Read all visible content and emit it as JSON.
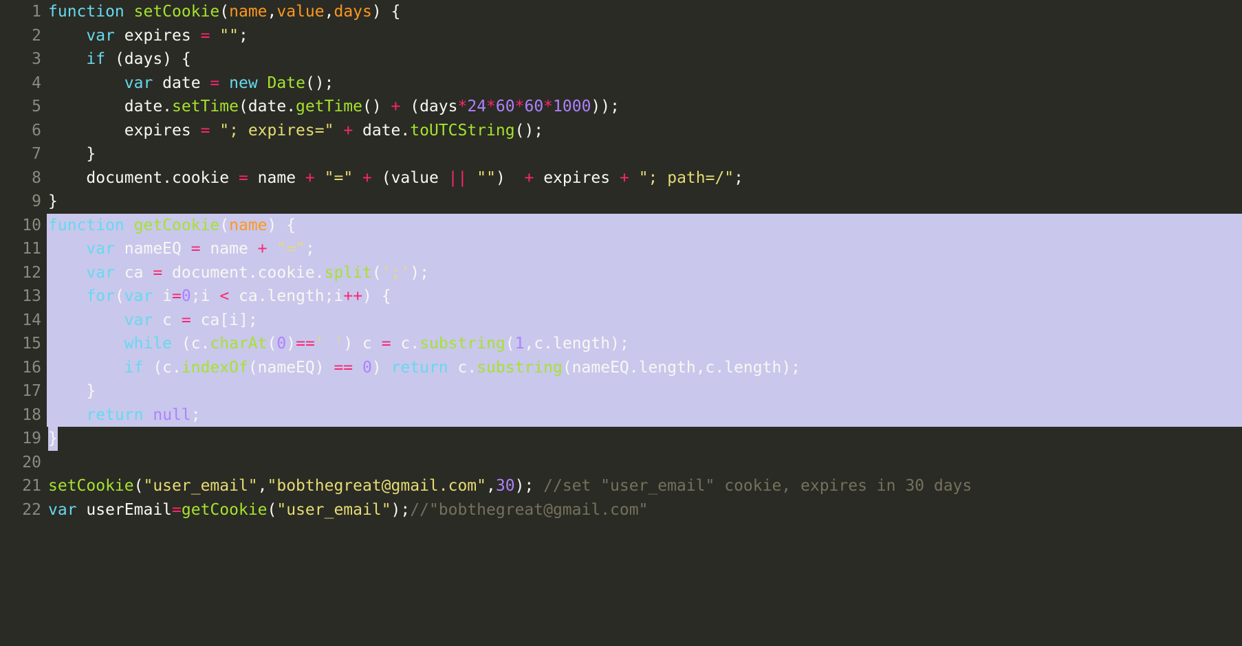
{
  "lineNumbers": [
    "1",
    "2",
    "3",
    "4",
    "5",
    "6",
    "7",
    "8",
    "9",
    "10",
    "11",
    "12",
    "13",
    "14",
    "15",
    "16",
    "17",
    "18",
    "19",
    "20",
    "21",
    "22"
  ],
  "selection": {
    "startLine": 10,
    "endLine": 19
  },
  "code": {
    "lines": [
      [
        {
          "t": "kw",
          "v": "function"
        },
        {
          "t": "id",
          "v": " "
        },
        {
          "t": "fn",
          "v": "setCookie"
        },
        {
          "t": "id",
          "v": "("
        },
        {
          "t": "arg",
          "v": "name"
        },
        {
          "t": "id",
          "v": ","
        },
        {
          "t": "arg",
          "v": "value"
        },
        {
          "t": "id",
          "v": ","
        },
        {
          "t": "arg",
          "v": "days"
        },
        {
          "t": "id",
          "v": ") {"
        }
      ],
      [
        {
          "t": "id",
          "v": "    "
        },
        {
          "t": "kw",
          "v": "var"
        },
        {
          "t": "id",
          "v": " expires "
        },
        {
          "t": "op",
          "v": "="
        },
        {
          "t": "id",
          "v": " "
        },
        {
          "t": "str",
          "v": "\"\""
        },
        {
          "t": "id",
          "v": ";"
        }
      ],
      [
        {
          "t": "id",
          "v": "    "
        },
        {
          "t": "kw",
          "v": "if"
        },
        {
          "t": "id",
          "v": " (days) {"
        }
      ],
      [
        {
          "t": "id",
          "v": "        "
        },
        {
          "t": "kw",
          "v": "var"
        },
        {
          "t": "id",
          "v": " date "
        },
        {
          "t": "op",
          "v": "="
        },
        {
          "t": "id",
          "v": " "
        },
        {
          "t": "kw",
          "v": "new"
        },
        {
          "t": "id",
          "v": " "
        },
        {
          "t": "fn",
          "v": "Date"
        },
        {
          "t": "id",
          "v": "();"
        }
      ],
      [
        {
          "t": "id",
          "v": "        date."
        },
        {
          "t": "fn",
          "v": "setTime"
        },
        {
          "t": "id",
          "v": "(date."
        },
        {
          "t": "fn",
          "v": "getTime"
        },
        {
          "t": "id",
          "v": "() "
        },
        {
          "t": "op",
          "v": "+"
        },
        {
          "t": "id",
          "v": " (days"
        },
        {
          "t": "op",
          "v": "*"
        },
        {
          "t": "num",
          "v": "24"
        },
        {
          "t": "op",
          "v": "*"
        },
        {
          "t": "num",
          "v": "60"
        },
        {
          "t": "op",
          "v": "*"
        },
        {
          "t": "num",
          "v": "60"
        },
        {
          "t": "op",
          "v": "*"
        },
        {
          "t": "num",
          "v": "1000"
        },
        {
          "t": "id",
          "v": "));"
        }
      ],
      [
        {
          "t": "id",
          "v": "        expires "
        },
        {
          "t": "op",
          "v": "="
        },
        {
          "t": "id",
          "v": " "
        },
        {
          "t": "str",
          "v": "\"; expires=\""
        },
        {
          "t": "id",
          "v": " "
        },
        {
          "t": "op",
          "v": "+"
        },
        {
          "t": "id",
          "v": " date."
        },
        {
          "t": "fn",
          "v": "toUTCString"
        },
        {
          "t": "id",
          "v": "();"
        }
      ],
      [
        {
          "t": "id",
          "v": "    }"
        }
      ],
      [
        {
          "t": "id",
          "v": "    document.cookie "
        },
        {
          "t": "op",
          "v": "="
        },
        {
          "t": "id",
          "v": " name "
        },
        {
          "t": "op",
          "v": "+"
        },
        {
          "t": "id",
          "v": " "
        },
        {
          "t": "str",
          "v": "\"=\""
        },
        {
          "t": "id",
          "v": " "
        },
        {
          "t": "op",
          "v": "+"
        },
        {
          "t": "id",
          "v": " (value "
        },
        {
          "t": "op",
          "v": "||"
        },
        {
          "t": "id",
          "v": " "
        },
        {
          "t": "str",
          "v": "\"\""
        },
        {
          "t": "id",
          "v": ")  "
        },
        {
          "t": "op",
          "v": "+"
        },
        {
          "t": "id",
          "v": " expires "
        },
        {
          "t": "op",
          "v": "+"
        },
        {
          "t": "id",
          "v": " "
        },
        {
          "t": "str",
          "v": "\"; path=/\""
        },
        {
          "t": "id",
          "v": ";"
        }
      ],
      [
        {
          "t": "id",
          "v": "}"
        }
      ],
      [
        {
          "t": "kw",
          "v": "function"
        },
        {
          "t": "id",
          "v": " "
        },
        {
          "t": "fn",
          "v": "getCookie"
        },
        {
          "t": "id",
          "v": "("
        },
        {
          "t": "arg",
          "v": "name"
        },
        {
          "t": "id",
          "v": ") {"
        }
      ],
      [
        {
          "t": "id",
          "v": "    "
        },
        {
          "t": "kw",
          "v": "var"
        },
        {
          "t": "id",
          "v": " nameEQ "
        },
        {
          "t": "op",
          "v": "="
        },
        {
          "t": "id",
          "v": " name "
        },
        {
          "t": "op",
          "v": "+"
        },
        {
          "t": "id",
          "v": " "
        },
        {
          "t": "str",
          "v": "\"=\""
        },
        {
          "t": "id",
          "v": ";"
        }
      ],
      [
        {
          "t": "id",
          "v": "    "
        },
        {
          "t": "kw",
          "v": "var"
        },
        {
          "t": "id",
          "v": " ca "
        },
        {
          "t": "op",
          "v": "="
        },
        {
          "t": "id",
          "v": " document.cookie."
        },
        {
          "t": "fn",
          "v": "split"
        },
        {
          "t": "id",
          "v": "("
        },
        {
          "t": "str",
          "v": "';'"
        },
        {
          "t": "id",
          "v": ");"
        }
      ],
      [
        {
          "t": "id",
          "v": "    "
        },
        {
          "t": "kw",
          "v": "for"
        },
        {
          "t": "id",
          "v": "("
        },
        {
          "t": "kw",
          "v": "var"
        },
        {
          "t": "id",
          "v": " i"
        },
        {
          "t": "op",
          "v": "="
        },
        {
          "t": "num",
          "v": "0"
        },
        {
          "t": "id",
          "v": ";i "
        },
        {
          "t": "op",
          "v": "<"
        },
        {
          "t": "id",
          "v": " ca.length;i"
        },
        {
          "t": "op",
          "v": "++"
        },
        {
          "t": "id",
          "v": ") {"
        }
      ],
      [
        {
          "t": "id",
          "v": "        "
        },
        {
          "t": "kw",
          "v": "var"
        },
        {
          "t": "id",
          "v": " c "
        },
        {
          "t": "op",
          "v": "="
        },
        {
          "t": "id",
          "v": " ca[i];"
        }
      ],
      [
        {
          "t": "id",
          "v": "        "
        },
        {
          "t": "kw",
          "v": "while"
        },
        {
          "t": "id",
          "v": " (c."
        },
        {
          "t": "fn",
          "v": "charAt"
        },
        {
          "t": "id",
          "v": "("
        },
        {
          "t": "num",
          "v": "0"
        },
        {
          "t": "id",
          "v": ")"
        },
        {
          "t": "op",
          "v": "=="
        },
        {
          "t": "str",
          "v": "' '"
        },
        {
          "t": "id",
          "v": ") c "
        },
        {
          "t": "op",
          "v": "="
        },
        {
          "t": "id",
          "v": " c."
        },
        {
          "t": "fn",
          "v": "substring"
        },
        {
          "t": "id",
          "v": "("
        },
        {
          "t": "num",
          "v": "1"
        },
        {
          "t": "id",
          "v": ",c.length);"
        }
      ],
      [
        {
          "t": "id",
          "v": "        "
        },
        {
          "t": "kw",
          "v": "if"
        },
        {
          "t": "id",
          "v": " (c."
        },
        {
          "t": "fn",
          "v": "indexOf"
        },
        {
          "t": "id",
          "v": "(nameEQ) "
        },
        {
          "t": "op",
          "v": "=="
        },
        {
          "t": "id",
          "v": " "
        },
        {
          "t": "num",
          "v": "0"
        },
        {
          "t": "id",
          "v": ") "
        },
        {
          "t": "kw",
          "v": "return"
        },
        {
          "t": "id",
          "v": " c."
        },
        {
          "t": "fn",
          "v": "substring"
        },
        {
          "t": "id",
          "v": "(nameEQ.length,c.length);"
        }
      ],
      [
        {
          "t": "id",
          "v": "    }"
        }
      ],
      [
        {
          "t": "id",
          "v": "    "
        },
        {
          "t": "kw",
          "v": "return"
        },
        {
          "t": "id",
          "v": " "
        },
        {
          "t": "nul",
          "v": "null"
        },
        {
          "t": "id",
          "v": ";"
        }
      ],
      [
        {
          "t": "id",
          "v": "}"
        }
      ],
      [
        {
          "t": "id",
          "v": ""
        }
      ],
      [
        {
          "t": "fn",
          "v": "setCookie"
        },
        {
          "t": "id",
          "v": "("
        },
        {
          "t": "str",
          "v": "\"user_email\""
        },
        {
          "t": "id",
          "v": ","
        },
        {
          "t": "str",
          "v": "\"bobthegreat@gmail.com\""
        },
        {
          "t": "id",
          "v": ","
        },
        {
          "t": "num",
          "v": "30"
        },
        {
          "t": "id",
          "v": "); "
        },
        {
          "t": "cm",
          "v": "//set \"user_email\" cookie, expires in 30 days"
        }
      ],
      [
        {
          "t": "kw",
          "v": "var"
        },
        {
          "t": "id",
          "v": " userEmail"
        },
        {
          "t": "op",
          "v": "="
        },
        {
          "t": "fn",
          "v": "getCookie"
        },
        {
          "t": "id",
          "v": "("
        },
        {
          "t": "str",
          "v": "\"user_email\""
        },
        {
          "t": "id",
          "v": ");"
        },
        {
          "t": "cm",
          "v": "//\"bobthegreat@gmail.com\""
        }
      ]
    ]
  }
}
